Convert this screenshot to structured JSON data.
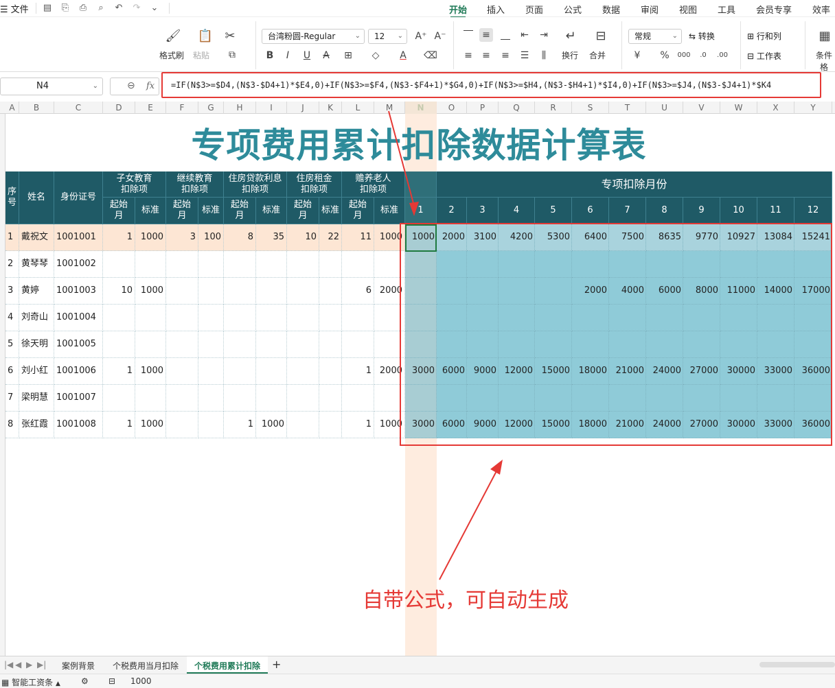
{
  "menu": {
    "left_label": "文件",
    "tabs": [
      "开始",
      "插入",
      "页面",
      "公式",
      "数据",
      "审阅",
      "视图",
      "工具",
      "会员专享",
      "效率"
    ],
    "active_tab": "开始"
  },
  "ribbon": {
    "format_painter": "格式刷",
    "paste": "粘贴",
    "font_name": "台湾粉圆-Regular",
    "font_size": "12",
    "wrap": "换行",
    "merge": "合并",
    "number_format": "常规",
    "convert": "转换",
    "rowcol": "行和列",
    "worksheet": "工作表",
    "cond": "条件格"
  },
  "formula_bar": {
    "cell_ref": "N4",
    "fx": "fx",
    "formula": "=IF(N$3>=$D4,(N$3-$D4+1)*$E4,0)+IF(N$3>=$F4,(N$3-$F4+1)*$G4,0)+IF(N$3>=$H4,(N$3-$H4+1)*$I4,0)+IF(N$3>=$J4,(N$3-$J4+1)*$K4"
  },
  "columns": [
    "A",
    "B",
    "C",
    "D",
    "E",
    "F",
    "G",
    "H",
    "I",
    "J",
    "K",
    "L",
    "M",
    "N",
    "O",
    "P",
    "Q",
    "R",
    "S",
    "T",
    "U",
    "V",
    "W",
    "X",
    "Y"
  ],
  "title": "专项费用累计扣除数据计算表",
  "headers": {
    "seq": "序号",
    "name": "姓名",
    "id": "身份证号",
    "groups": [
      "子女教育扣除项",
      "继续教育扣除项",
      "住房贷款利息扣除项",
      "住房租金扣除项",
      "赡养老人扣除项"
    ],
    "group_lines": [
      [
        "子女教育",
        "扣除项"
      ],
      [
        "继续教育",
        "扣除项"
      ],
      [
        "住房贷款利息",
        "扣除项"
      ],
      [
        "住房租金",
        "扣除项"
      ],
      [
        "赡养老人",
        "扣除项"
      ]
    ],
    "start_month": "起始月",
    "standard": "标准",
    "months_title": "专项扣除月份",
    "months": [
      "1",
      "2",
      "3",
      "4",
      "5",
      "6",
      "7",
      "8",
      "9",
      "10",
      "11",
      "12"
    ]
  },
  "rows": [
    {
      "seq": "1",
      "name": "戴祝文",
      "id": "1001001",
      "d": [
        "1",
        "1000",
        "3",
        "100",
        "8",
        "35",
        "10",
        "22",
        "11",
        "1000"
      ],
      "m": [
        "1000",
        "2000",
        "3100",
        "4200",
        "5300",
        "6400",
        "7500",
        "8635",
        "9770",
        "10927",
        "13084",
        "15241"
      ]
    },
    {
      "seq": "2",
      "name": "黄琴琴",
      "id": "1001002",
      "d": [
        "",
        "",
        "",
        "",
        "",
        "",
        "",
        "",
        "",
        ""
      ],
      "m": [
        "",
        "",
        "",
        "",
        "",
        "",
        "",
        "",
        "",
        "",
        "",
        ""
      ]
    },
    {
      "seq": "3",
      "name": "黄婷",
      "id": "1001003",
      "d": [
        "10",
        "1000",
        "",
        "",
        "",
        "",
        "",
        "",
        "6",
        "2000"
      ],
      "m": [
        "",
        "",
        "",
        "",
        "",
        "2000",
        "4000",
        "6000",
        "8000",
        "11000",
        "14000",
        "17000"
      ]
    },
    {
      "seq": "4",
      "name": "刘奇山",
      "id": "1001004",
      "d": [
        "",
        "",
        "",
        "",
        "",
        "",
        "",
        "",
        "",
        ""
      ],
      "m": [
        "",
        "",
        "",
        "",
        "",
        "",
        "",
        "",
        "",
        "",
        "",
        ""
      ]
    },
    {
      "seq": "5",
      "name": "徐天明",
      "id": "1001005",
      "d": [
        "",
        "",
        "",
        "",
        "",
        "",
        "",
        "",
        "",
        ""
      ],
      "m": [
        "",
        "",
        "",
        "",
        "",
        "",
        "",
        "",
        "",
        "",
        "",
        ""
      ]
    },
    {
      "seq": "6",
      "name": "刘小红",
      "id": "1001006",
      "d": [
        "1",
        "1000",
        "",
        "",
        "",
        "",
        "",
        "",
        "1",
        "2000"
      ],
      "m": [
        "3000",
        "6000",
        "9000",
        "12000",
        "15000",
        "18000",
        "21000",
        "24000",
        "27000",
        "30000",
        "33000",
        "36000"
      ]
    },
    {
      "seq": "7",
      "name": "梁明慧",
      "id": "1001007",
      "d": [
        "",
        "",
        "",
        "",
        "",
        "",
        "",
        "",
        "",
        ""
      ],
      "m": [
        "",
        "",
        "",
        "",
        "",
        "",
        "",
        "",
        "",
        "",
        "",
        ""
      ]
    },
    {
      "seq": "8",
      "name": "张红霞",
      "id": "1001008",
      "d": [
        "1",
        "1000",
        "",
        "",
        "1",
        "1000",
        "",
        "",
        "1",
        "1000"
      ],
      "m": [
        "3000",
        "6000",
        "9000",
        "12000",
        "15000",
        "18000",
        "21000",
        "24000",
        "27000",
        "30000",
        "33000",
        "36000"
      ]
    }
  ],
  "annotation": "自带公式，可自动生成",
  "sheet_tabs": [
    "案例背景",
    "个税费用当月扣除",
    "个税费用累计扣除"
  ],
  "active_sheet": "个税费用累计扣除",
  "status": {
    "app": "智能工资条",
    "value": "1000"
  },
  "colors": {
    "header_bg": "#1f5a66",
    "title": "#2e8b9a",
    "annot": "#e53935",
    "accent": "#1f7a57",
    "month_fill": "#8fcbd8"
  }
}
